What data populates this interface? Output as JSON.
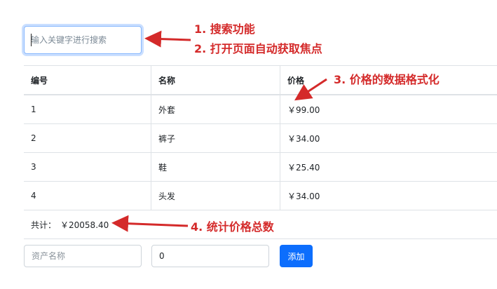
{
  "search": {
    "placeholder": "输入关键字进行搜索",
    "value": ""
  },
  "table": {
    "headers": {
      "id": "编号",
      "name": "名称",
      "price": "价格"
    },
    "rows": [
      {
        "id": "1",
        "name": "外套",
        "price": "￥99.00"
      },
      {
        "id": "2",
        "name": "裤子",
        "price": "￥34.00"
      },
      {
        "id": "3",
        "name": "鞋",
        "price": "￥25.40"
      },
      {
        "id": "4",
        "name": "头发",
        "price": "￥34.00"
      }
    ],
    "footer": {
      "label": "共计：",
      "amount": "￥20058.40"
    }
  },
  "form": {
    "name_placeholder": "资产名称",
    "price_value": "0",
    "add_label": "添加"
  },
  "annotations": {
    "a1": "1. 搜索功能",
    "a2": "2. 打开页面自动获取焦点",
    "a3": "3. 价格的数据格式化",
    "a4": "4. 统计价格总数"
  },
  "colors": {
    "annotation": "#d42a2a",
    "primary": "#0d6efd",
    "focus_border": "#86b7fe"
  }
}
